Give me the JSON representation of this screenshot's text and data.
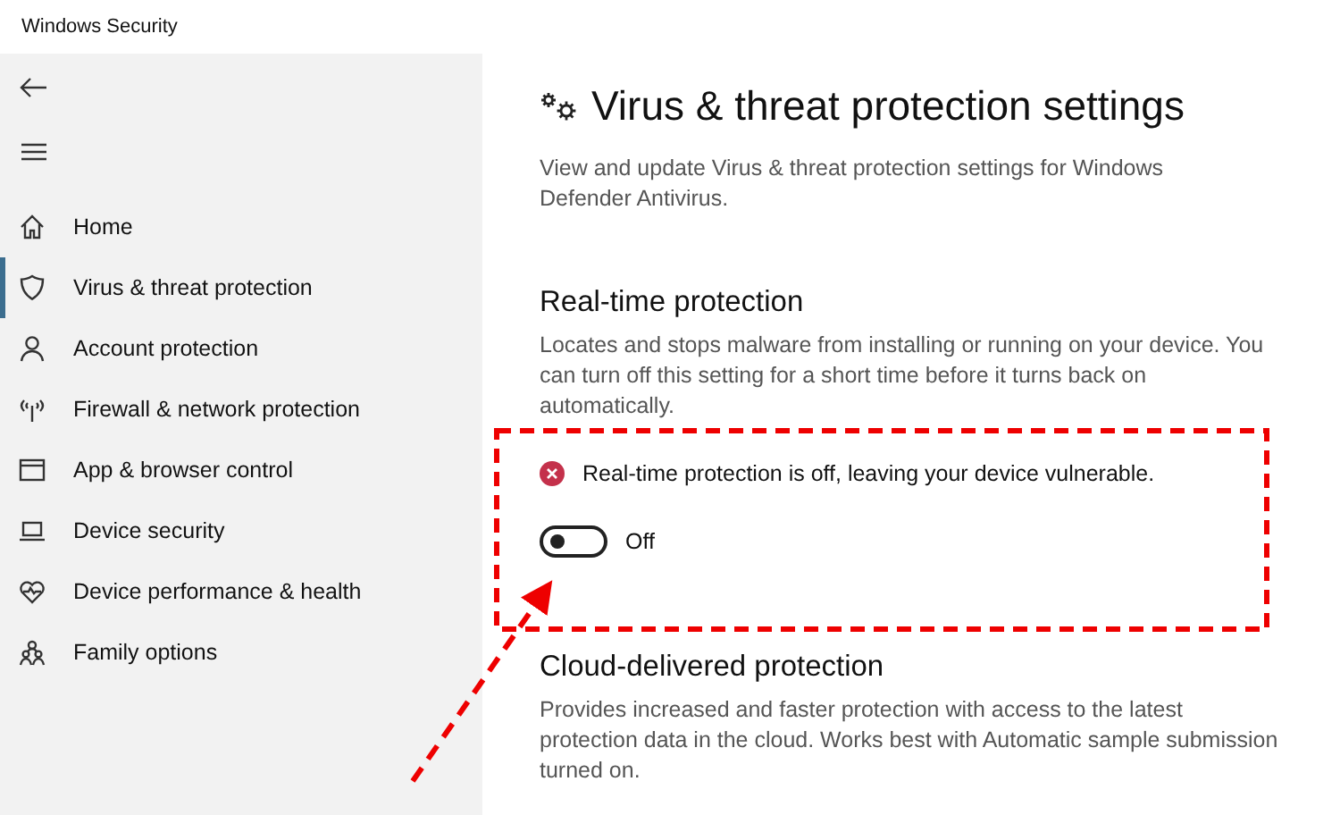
{
  "window": {
    "title": "Windows Security"
  },
  "sidebar": {
    "items": [
      {
        "label": "Home",
        "selected": false
      },
      {
        "label": "Virus & threat protection",
        "selected": true
      },
      {
        "label": "Account protection",
        "selected": false
      },
      {
        "label": "Firewall & network protection",
        "selected": false
      },
      {
        "label": "App & browser control",
        "selected": false
      },
      {
        "label": "Device security",
        "selected": false
      },
      {
        "label": "Device performance & health",
        "selected": false
      },
      {
        "label": "Family options",
        "selected": false
      }
    ]
  },
  "page": {
    "title": "Virus & threat protection settings",
    "description": "View and update Virus & threat protection settings for Windows Defender Antivirus.",
    "sections": [
      {
        "heading": "Real-time protection",
        "description": "Locates and stops malware from installing or running on your device. You can turn off this setting for a short time before it turns back on automatically.",
        "alert": {
          "kind": "error",
          "text": "Real-time protection is off, leaving your device vulnerable."
        },
        "toggle": {
          "on": false,
          "label": "Off"
        }
      },
      {
        "heading": "Cloud-delivered protection",
        "description": "Provides increased and faster protection with access to the latest protection data in the cloud. Works best with Automatic sample submission turned on."
      }
    ]
  }
}
